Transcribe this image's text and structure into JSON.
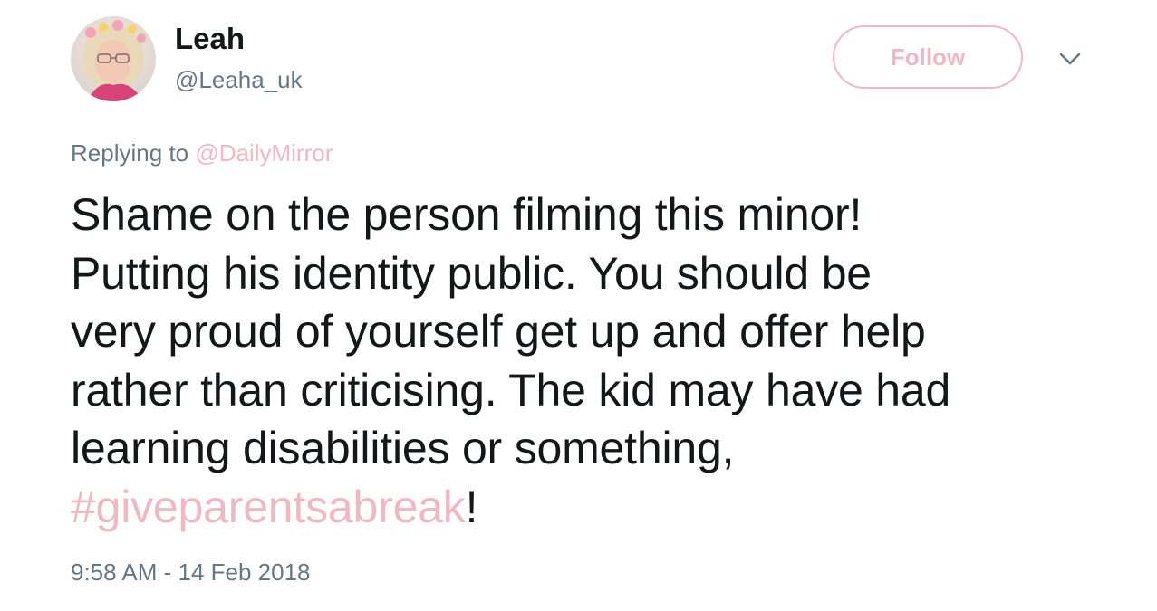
{
  "author": {
    "name": "Leah",
    "handle": "@Leaha_uk",
    "avatar_icon": "user-avatar-photo"
  },
  "header": {
    "follow_label": "Follow",
    "menu_icon": "chevron-down-icon"
  },
  "reply": {
    "prefix": "Replying to",
    "mention": "@DailyMirror"
  },
  "tweet": {
    "lines": [
      "Shame on the person filming this minor!",
      "Putting his identity public. You should be",
      "very proud of yourself get up and offer help",
      "rather than criticising. The kid may have had",
      "learning disabilities or something,"
    ],
    "hashtag": "#giveparentsabreak",
    "trailing": "!"
  },
  "meta": {
    "timestamp": "9:58 AM - 14 Feb 2018"
  },
  "colors": {
    "accent": "#f0b8c3",
    "text": "#14171a",
    "secondary": "#657786",
    "background": "#ffffff"
  }
}
